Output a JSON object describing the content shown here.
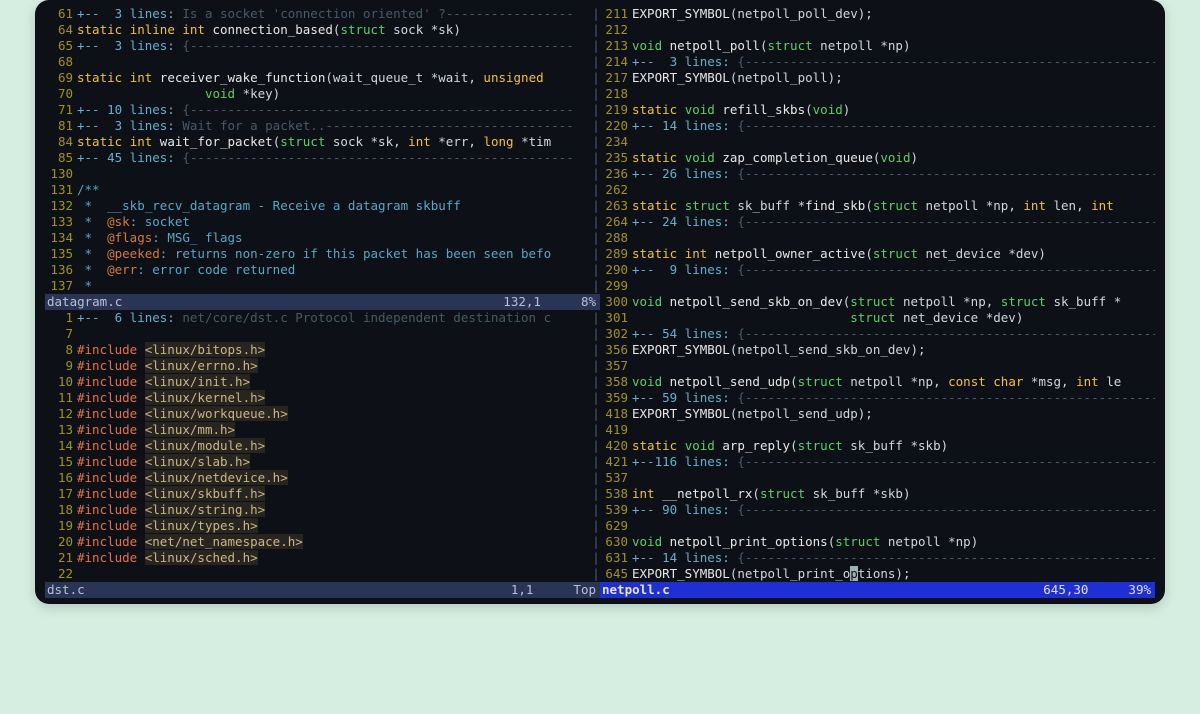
{
  "panes": {
    "topleft": {
      "status": {
        "file": "datagram.c",
        "pos": "132,1",
        "pct": "8%"
      },
      "lines": [
        {
          "n": "61",
          "fold": true,
          "marker": "+--  3 lines:",
          "text": " Is a socket 'connection oriented' ?",
          "dash": true
        },
        {
          "n": "64",
          "tokens": [
            [
              "kw",
              "static "
            ],
            [
              "kw",
              "inline "
            ],
            [
              "kw",
              "int "
            ],
            [
              "func",
              "connection_based"
            ],
            [
              "ident",
              "("
            ],
            [
              "type",
              "struct "
            ],
            [
              "ident",
              "sock *sk)"
            ]
          ]
        },
        {
          "n": "65",
          "fold": true,
          "marker": "+--  3 lines:",
          "text": " {",
          "dash": true
        },
        {
          "n": "68",
          "tokens": []
        },
        {
          "n": "69",
          "tokens": [
            [
              "kw",
              "static "
            ],
            [
              "kw",
              "int "
            ],
            [
              "func",
              "receiver_wake_function"
            ],
            [
              "ident",
              "(wait_queue_t *wait, "
            ],
            [
              "kw",
              "unsigned"
            ]
          ]
        },
        {
          "n": "70",
          "tokens": [
            [
              "ident",
              "                 "
            ],
            [
              "type",
              "void "
            ],
            [
              "ident",
              "*key)"
            ]
          ]
        },
        {
          "n": "71",
          "fold": true,
          "marker": "+-- 10 lines:",
          "text": " {",
          "dash": true
        },
        {
          "n": "81",
          "fold": true,
          "marker": "+--  3 lines:",
          "text": " Wait for a packet..",
          "dash": true
        },
        {
          "n": "84",
          "tokens": [
            [
              "kw",
              "static "
            ],
            [
              "kw",
              "int "
            ],
            [
              "func",
              "wait_for_packet"
            ],
            [
              "ident",
              "("
            ],
            [
              "type",
              "struct "
            ],
            [
              "ident",
              "sock *sk, "
            ],
            [
              "kw",
              "int "
            ],
            [
              "ident",
              "*err, "
            ],
            [
              "kw",
              "long "
            ],
            [
              "ident",
              "*tim"
            ]
          ]
        },
        {
          "n": "85",
          "fold": true,
          "marker": "+-- 45 lines:",
          "text": " {",
          "dash": true
        },
        {
          "n": "130",
          "tokens": []
        },
        {
          "n": "131",
          "tokens": [
            [
              "comment",
              "/**"
            ]
          ]
        },
        {
          "n": "132",
          "tokens": [
            [
              "comment",
              " *  __skb_recv_datagram - Receive a datagram skbuff"
            ]
          ]
        },
        {
          "n": "133",
          "tokens": [
            [
              "comment",
              " *  "
            ],
            [
              "doctag",
              "@sk"
            ],
            [
              "comment",
              ": socket"
            ]
          ]
        },
        {
          "n": "134",
          "tokens": [
            [
              "comment",
              " *  "
            ],
            [
              "doctag",
              "@flags"
            ],
            [
              "comment",
              ": MSG_ flags"
            ]
          ]
        },
        {
          "n": "135",
          "tokens": [
            [
              "comment",
              " *  "
            ],
            [
              "doctag",
              "@peeked"
            ],
            [
              "comment",
              ": returns non-zero if this packet has been seen befo"
            ]
          ]
        },
        {
          "n": "136",
          "tokens": [
            [
              "comment",
              " *  "
            ],
            [
              "doctag",
              "@err"
            ],
            [
              "comment",
              ": error code returned"
            ]
          ]
        },
        {
          "n": "137",
          "tokens": [
            [
              "comment",
              " *"
            ]
          ]
        }
      ]
    },
    "bottomleft": {
      "status": {
        "file": "dst.c",
        "pos": "1,1",
        "pct": "Top"
      },
      "lines": [
        {
          "n": "1",
          "fold": true,
          "marker": "+--  6 lines:",
          "text": " net/core/dst.c Protocol independent destination c",
          "dash": false
        },
        {
          "n": "7",
          "tokens": []
        },
        {
          "n": "8",
          "tokens": [
            [
              "preproc",
              "#include "
            ],
            [
              "string",
              "<linux/bitops.h>"
            ]
          ]
        },
        {
          "n": "9",
          "tokens": [
            [
              "preproc",
              "#include "
            ],
            [
              "string",
              "<linux/errno.h>"
            ]
          ]
        },
        {
          "n": "10",
          "tokens": [
            [
              "preproc",
              "#include "
            ],
            [
              "string",
              "<linux/init.h>"
            ]
          ]
        },
        {
          "n": "11",
          "tokens": [
            [
              "preproc",
              "#include "
            ],
            [
              "string",
              "<linux/kernel.h>"
            ]
          ]
        },
        {
          "n": "12",
          "tokens": [
            [
              "preproc",
              "#include "
            ],
            [
              "string",
              "<linux/workqueue.h>"
            ]
          ]
        },
        {
          "n": "13",
          "tokens": [
            [
              "preproc",
              "#include "
            ],
            [
              "string",
              "<linux/mm.h>"
            ]
          ]
        },
        {
          "n": "14",
          "tokens": [
            [
              "preproc",
              "#include "
            ],
            [
              "string",
              "<linux/module.h>"
            ]
          ]
        },
        {
          "n": "15",
          "tokens": [
            [
              "preproc",
              "#include "
            ],
            [
              "string",
              "<linux/slab.h>"
            ]
          ]
        },
        {
          "n": "16",
          "tokens": [
            [
              "preproc",
              "#include "
            ],
            [
              "string",
              "<linux/netdevice.h>"
            ]
          ]
        },
        {
          "n": "17",
          "tokens": [
            [
              "preproc",
              "#include "
            ],
            [
              "string",
              "<linux/skbuff.h>"
            ]
          ]
        },
        {
          "n": "18",
          "tokens": [
            [
              "preproc",
              "#include "
            ],
            [
              "string",
              "<linux/string.h>"
            ]
          ]
        },
        {
          "n": "19",
          "tokens": [
            [
              "preproc",
              "#include "
            ],
            [
              "string",
              "<linux/types.h>"
            ]
          ]
        },
        {
          "n": "20",
          "tokens": [
            [
              "preproc",
              "#include "
            ],
            [
              "string",
              "<net/net_namespace.h>"
            ]
          ]
        },
        {
          "n": "21",
          "tokens": [
            [
              "preproc",
              "#include "
            ],
            [
              "string",
              "<linux/sched.h>"
            ]
          ]
        },
        {
          "n": "22",
          "tokens": []
        }
      ]
    },
    "right": {
      "status": {
        "file": "netpoll.c",
        "pos": "645,30",
        "pct": "39%"
      },
      "lines": [
        {
          "n": "211",
          "tokens": [
            [
              "func",
              "EXPORT_SYMBOL"
            ],
            [
              "ident",
              "(netpoll_poll_dev);"
            ]
          ]
        },
        {
          "n": "212",
          "tokens": []
        },
        {
          "n": "213",
          "tokens": [
            [
              "type",
              "void "
            ],
            [
              "func",
              "netpoll_poll"
            ],
            [
              "ident",
              "("
            ],
            [
              "type",
              "struct "
            ],
            [
              "ident",
              "netpoll *np)"
            ]
          ]
        },
        {
          "n": "214",
          "fold": true,
          "marker": "+--  3 lines:",
          "text": " {",
          "dash": true
        },
        {
          "n": "217",
          "tokens": [
            [
              "func",
              "EXPORT_SYMBOL"
            ],
            [
              "ident",
              "(netpoll_poll);"
            ]
          ]
        },
        {
          "n": "218",
          "tokens": []
        },
        {
          "n": "219",
          "tokens": [
            [
              "kw",
              "static "
            ],
            [
              "type",
              "void "
            ],
            [
              "func",
              "refill_skbs"
            ],
            [
              "ident",
              "("
            ],
            [
              "type",
              "void"
            ],
            [
              "ident",
              ")"
            ]
          ]
        },
        {
          "n": "220",
          "fold": true,
          "marker": "+-- 14 lines:",
          "text": " {",
          "dash": true
        },
        {
          "n": "234",
          "tokens": []
        },
        {
          "n": "235",
          "tokens": [
            [
              "kw",
              "static "
            ],
            [
              "type",
              "void "
            ],
            [
              "func",
              "zap_completion_queue"
            ],
            [
              "ident",
              "("
            ],
            [
              "type",
              "void"
            ],
            [
              "ident",
              ")"
            ]
          ]
        },
        {
          "n": "236",
          "fold": true,
          "marker": "+-- 26 lines:",
          "text": " {",
          "dash": true
        },
        {
          "n": "262",
          "tokens": []
        },
        {
          "n": "263",
          "tokens": [
            [
              "kw",
              "static "
            ],
            [
              "type",
              "struct "
            ],
            [
              "ident",
              "sk_buff *"
            ],
            [
              "func",
              "find_skb"
            ],
            [
              "ident",
              "("
            ],
            [
              "type",
              "struct "
            ],
            [
              "ident",
              "netpoll *np, "
            ],
            [
              "kw",
              "int "
            ],
            [
              "ident",
              "len, "
            ],
            [
              "kw",
              "int"
            ]
          ]
        },
        {
          "n": "264",
          "fold": true,
          "marker": "+-- 24 lines:",
          "text": " {",
          "dash": true
        },
        {
          "n": "288",
          "tokens": []
        },
        {
          "n": "289",
          "tokens": [
            [
              "kw",
              "static "
            ],
            [
              "kw",
              "int "
            ],
            [
              "func",
              "netpoll_owner_active"
            ],
            [
              "ident",
              "("
            ],
            [
              "type",
              "struct "
            ],
            [
              "ident",
              "net_device *dev)"
            ]
          ]
        },
        {
          "n": "290",
          "fold": true,
          "marker": "+--  9 lines:",
          "text": " {",
          "dash": true
        },
        {
          "n": "299",
          "tokens": []
        },
        {
          "n": "300",
          "tokens": [
            [
              "type",
              "void "
            ],
            [
              "func",
              "netpoll_send_skb_on_dev"
            ],
            [
              "ident",
              "("
            ],
            [
              "type",
              "struct "
            ],
            [
              "ident",
              "netpoll *np, "
            ],
            [
              "type",
              "struct "
            ],
            [
              "ident",
              "sk_buff *"
            ]
          ]
        },
        {
          "n": "301",
          "tokens": [
            [
              "ident",
              "                             "
            ],
            [
              "type",
              "struct "
            ],
            [
              "ident",
              "net_device *dev)"
            ]
          ]
        },
        {
          "n": "302",
          "fold": true,
          "marker": "+-- 54 lines:",
          "text": " {",
          "dash": true
        },
        {
          "n": "356",
          "tokens": [
            [
              "func",
              "EXPORT_SYMBOL"
            ],
            [
              "ident",
              "(netpoll_send_skb_on_dev);"
            ]
          ]
        },
        {
          "n": "357",
          "tokens": []
        },
        {
          "n": "358",
          "tokens": [
            [
              "type",
              "void "
            ],
            [
              "func",
              "netpoll_send_udp"
            ],
            [
              "ident",
              "("
            ],
            [
              "type",
              "struct "
            ],
            [
              "ident",
              "netpoll *np, "
            ],
            [
              "kw",
              "const "
            ],
            [
              "kw",
              "char "
            ],
            [
              "ident",
              "*msg, "
            ],
            [
              "kw",
              "int "
            ],
            [
              "ident",
              "le"
            ]
          ]
        },
        {
          "n": "359",
          "fold": true,
          "marker": "+-- 59 lines:",
          "text": " {",
          "dash": true
        },
        {
          "n": "418",
          "tokens": [
            [
              "func",
              "EXPORT_SYMBOL"
            ],
            [
              "ident",
              "(netpoll_send_udp);"
            ]
          ]
        },
        {
          "n": "419",
          "tokens": []
        },
        {
          "n": "420",
          "tokens": [
            [
              "kw",
              "static "
            ],
            [
              "type",
              "void "
            ],
            [
              "func",
              "arp_reply"
            ],
            [
              "ident",
              "("
            ],
            [
              "type",
              "struct "
            ],
            [
              "ident",
              "sk_buff *skb)"
            ]
          ]
        },
        {
          "n": "421",
          "fold": true,
          "marker": "+--116 lines:",
          "text": " {",
          "dash": true
        },
        {
          "n": "537",
          "tokens": []
        },
        {
          "n": "538",
          "tokens": [
            [
              "kw",
              "int "
            ],
            [
              "func",
              "__netpoll_rx"
            ],
            [
              "ident",
              "("
            ],
            [
              "type",
              "struct "
            ],
            [
              "ident",
              "sk_buff *skb)"
            ]
          ]
        },
        {
          "n": "539",
          "fold": true,
          "marker": "+-- 90 lines:",
          "text": " {",
          "dash": true
        },
        {
          "n": "629",
          "tokens": []
        },
        {
          "n": "630",
          "tokens": [
            [
              "type",
              "void "
            ],
            [
              "func",
              "netpoll_print_options"
            ],
            [
              "ident",
              "("
            ],
            [
              "type",
              "struct "
            ],
            [
              "ident",
              "netpoll *np)"
            ]
          ]
        },
        {
          "n": "631",
          "fold": true,
          "marker": "+-- 14 lines:",
          "text": " {",
          "dash": true
        },
        {
          "n": "645",
          "cursor": 29,
          "tokens": [
            [
              "func",
              "EXPORT_SYMBOL"
            ],
            [
              "ident",
              "(netpoll_print_options);"
            ]
          ]
        }
      ]
    }
  }
}
